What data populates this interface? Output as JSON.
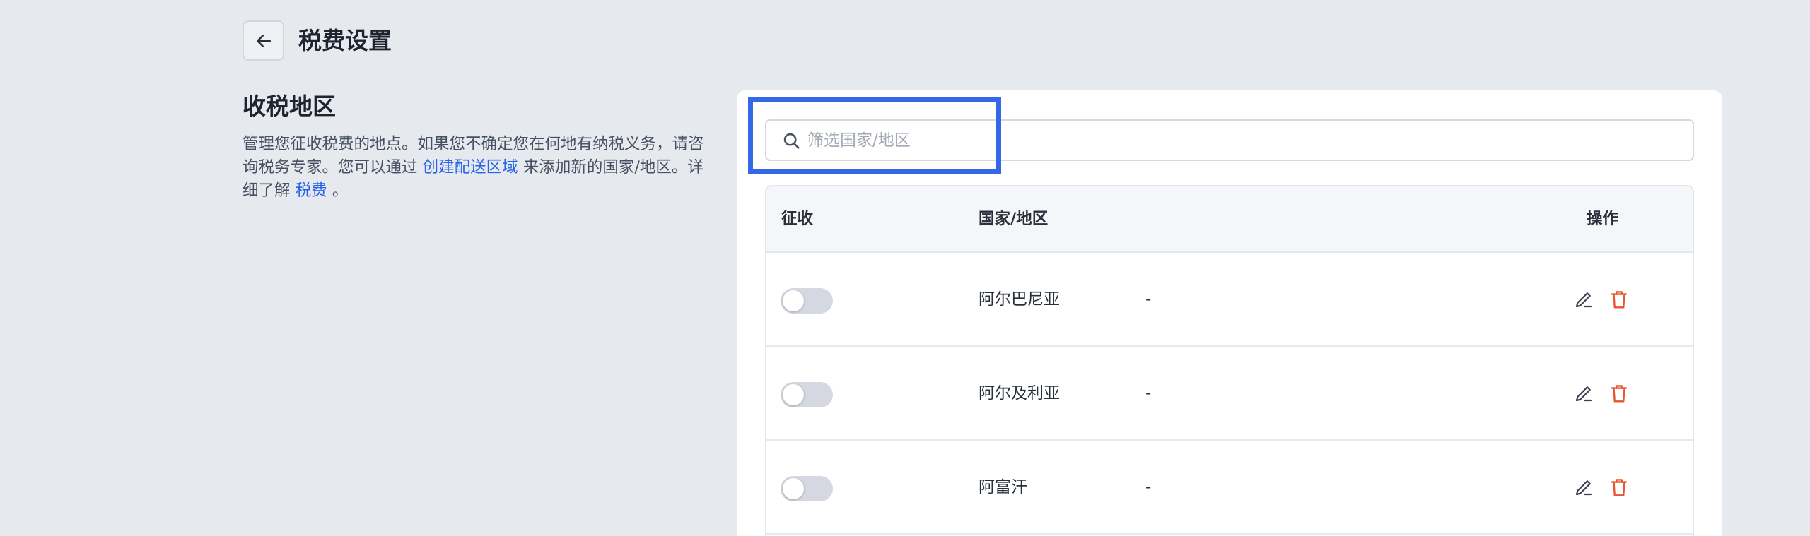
{
  "header": {
    "title": "税费设置"
  },
  "section": {
    "title": "收税地区",
    "desc_part1": "管理您征收税费的地点。如果您不确定您在何地有纳税义务，请咨询税务专家。您可以通过 ",
    "link1": "创建配送区域",
    "desc_part2": " 来添加新的国家/地区。详细了解 ",
    "link2": "税费",
    "desc_part3": " 。"
  },
  "search": {
    "value": "",
    "placeholder": "筛选国家/地区"
  },
  "table": {
    "columns": {
      "collect": "征收",
      "country": "国家/地区",
      "actions": "操作"
    },
    "rows": [
      {
        "country": "阿尔巴尼亚",
        "tax": "-",
        "collect": false
      },
      {
        "country": "阿尔及利亚",
        "tax": "-",
        "collect": false
      },
      {
        "country": "阿富汗",
        "tax": "-",
        "collect": false
      }
    ]
  },
  "colors": {
    "accent": "#2563eb",
    "highlight": "#3468e8",
    "delete": "#e8542f"
  }
}
